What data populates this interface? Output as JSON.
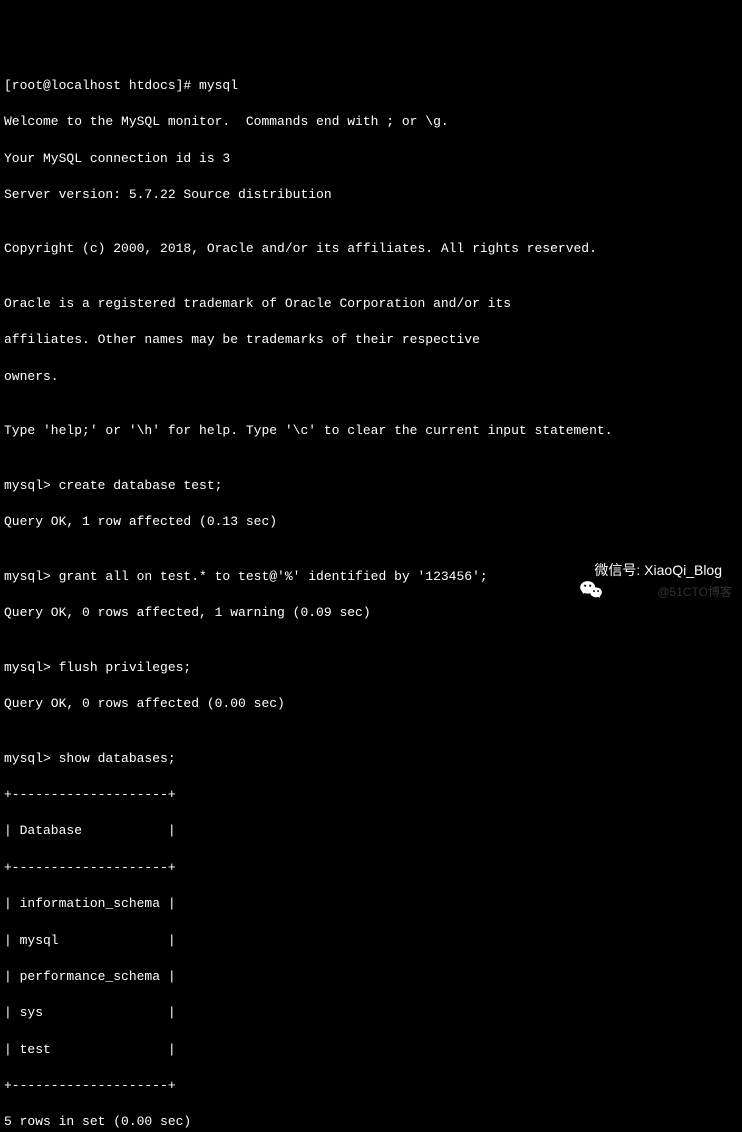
{
  "prompt_line": "[root@localhost htdocs]# mysql",
  "welcome": "Welcome to the MySQL monitor.  Commands end with ; or \\g.",
  "conn_id": "Your MySQL connection id is 3",
  "version": "Server version: 5.7.22 Source distribution",
  "copyright": "Copyright (c) 2000, 2018, Oracle and/or its affiliates. All rights reserved.",
  "trademark1": "Oracle is a registered trademark of Oracle Corporation and/or its",
  "trademark2": "affiliates. Other names may be trademarks of their respective",
  "trademark3": "owners.",
  "help_line": "Type 'help;' or '\\h' for help. Type '\\c' to clear the current input statement.",
  "cmd1_prompt": "mysql> create database test;",
  "cmd1_result": "Query OK, 1 row affected (0.13 sec)",
  "cmd2_prompt": "mysql> grant all on test.* to test@'%' identified by '123456';",
  "cmd2_result": "Query OK, 0 rows affected, 1 warning (0.09 sec)",
  "cmd3_prompt": "mysql> flush privileges;",
  "cmd3_result": "Query OK, 0 rows affected (0.00 sec)",
  "cmd4_prompt": "mysql> show databases;",
  "table_border": "+--------------------+",
  "table_header": "| Database           |",
  "table_row1": "| information_schema |",
  "table_row2": "| mysql              |",
  "table_row3": "| performance_schema |",
  "table_row4": "| sys                |",
  "table_row5": "| test               |",
  "table_footer": "5 rows in set (0.00 sec)",
  "watermark": "微信号: XiaoQi_Blog",
  "cto": "@51CTO博客"
}
